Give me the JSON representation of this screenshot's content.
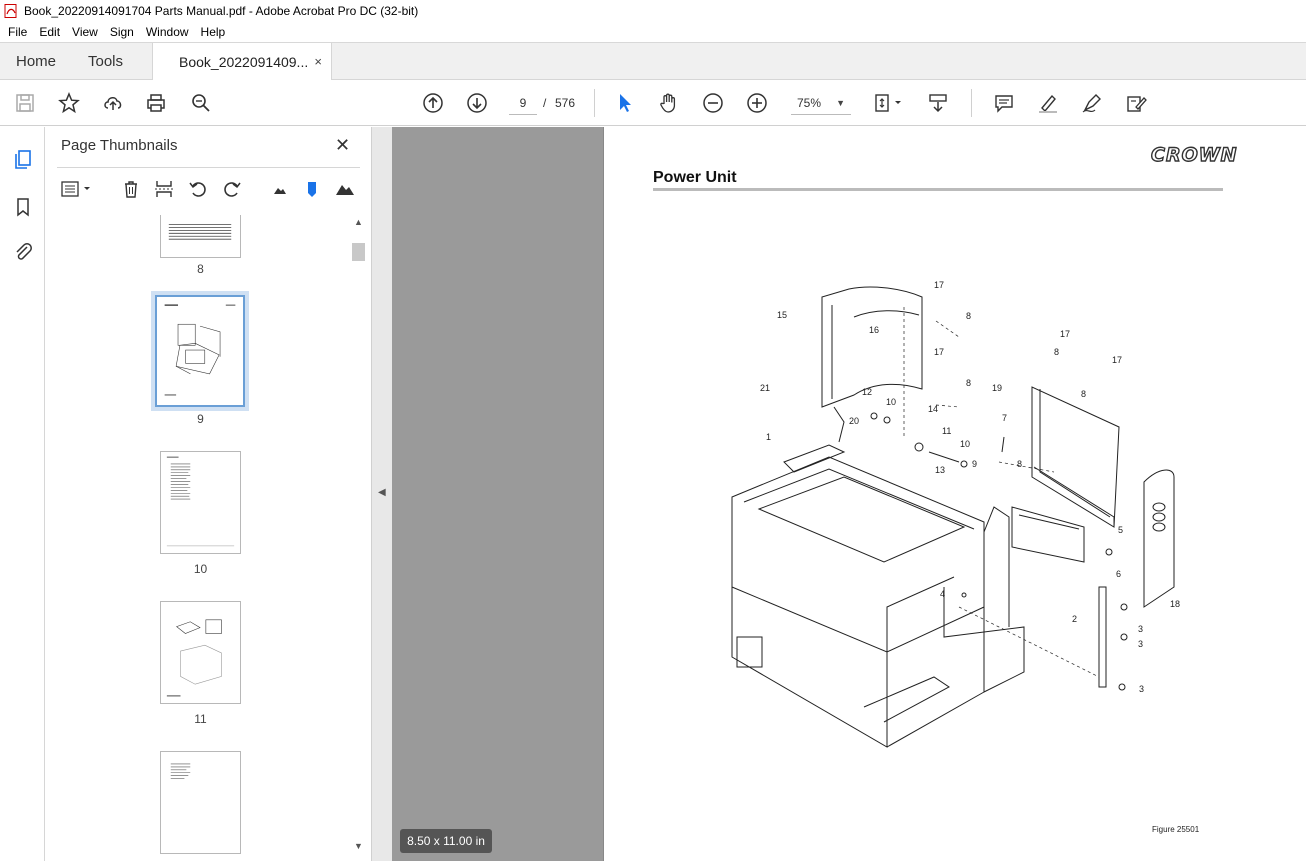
{
  "window": {
    "title": "Book_20220914091704 Parts Manual.pdf - Adobe Acrobat Pro DC (32-bit)"
  },
  "menu": [
    "File",
    "Edit",
    "View",
    "Sign",
    "Window",
    "Help"
  ],
  "tabs": {
    "home": "Home",
    "tools": "Tools",
    "doc": "Book_2022091409...",
    "close": "×"
  },
  "toolbar": {
    "page_current": "9",
    "page_sep": "/",
    "page_total": "576",
    "zoom": "75%"
  },
  "panel": {
    "title": "Page Thumbnails",
    "close": "✕",
    "thumbnails": [
      {
        "label": "8"
      },
      {
        "label": "9",
        "selected": true
      },
      {
        "label": "10"
      },
      {
        "label": "11"
      },
      {
        "label": ""
      }
    ]
  },
  "document": {
    "logo": "CROWN",
    "heading": "Power Unit",
    "figure_label": "Figure 25501",
    "page_size": "8.50 x 11.00 in",
    "callouts": [
      "1",
      "2",
      "3",
      "3",
      "3",
      "4",
      "5",
      "6",
      "7",
      "8",
      "8",
      "8",
      "8",
      "8",
      "9",
      "10",
      "10",
      "11",
      "12",
      "13",
      "14",
      "15",
      "16",
      "17",
      "17",
      "17",
      "17",
      "18",
      "19",
      "20",
      "21"
    ]
  },
  "colors": {
    "accent": "#1a73e8",
    "viewer_bg": "#9a9a9a",
    "selected_border": "#6a9fd6"
  }
}
